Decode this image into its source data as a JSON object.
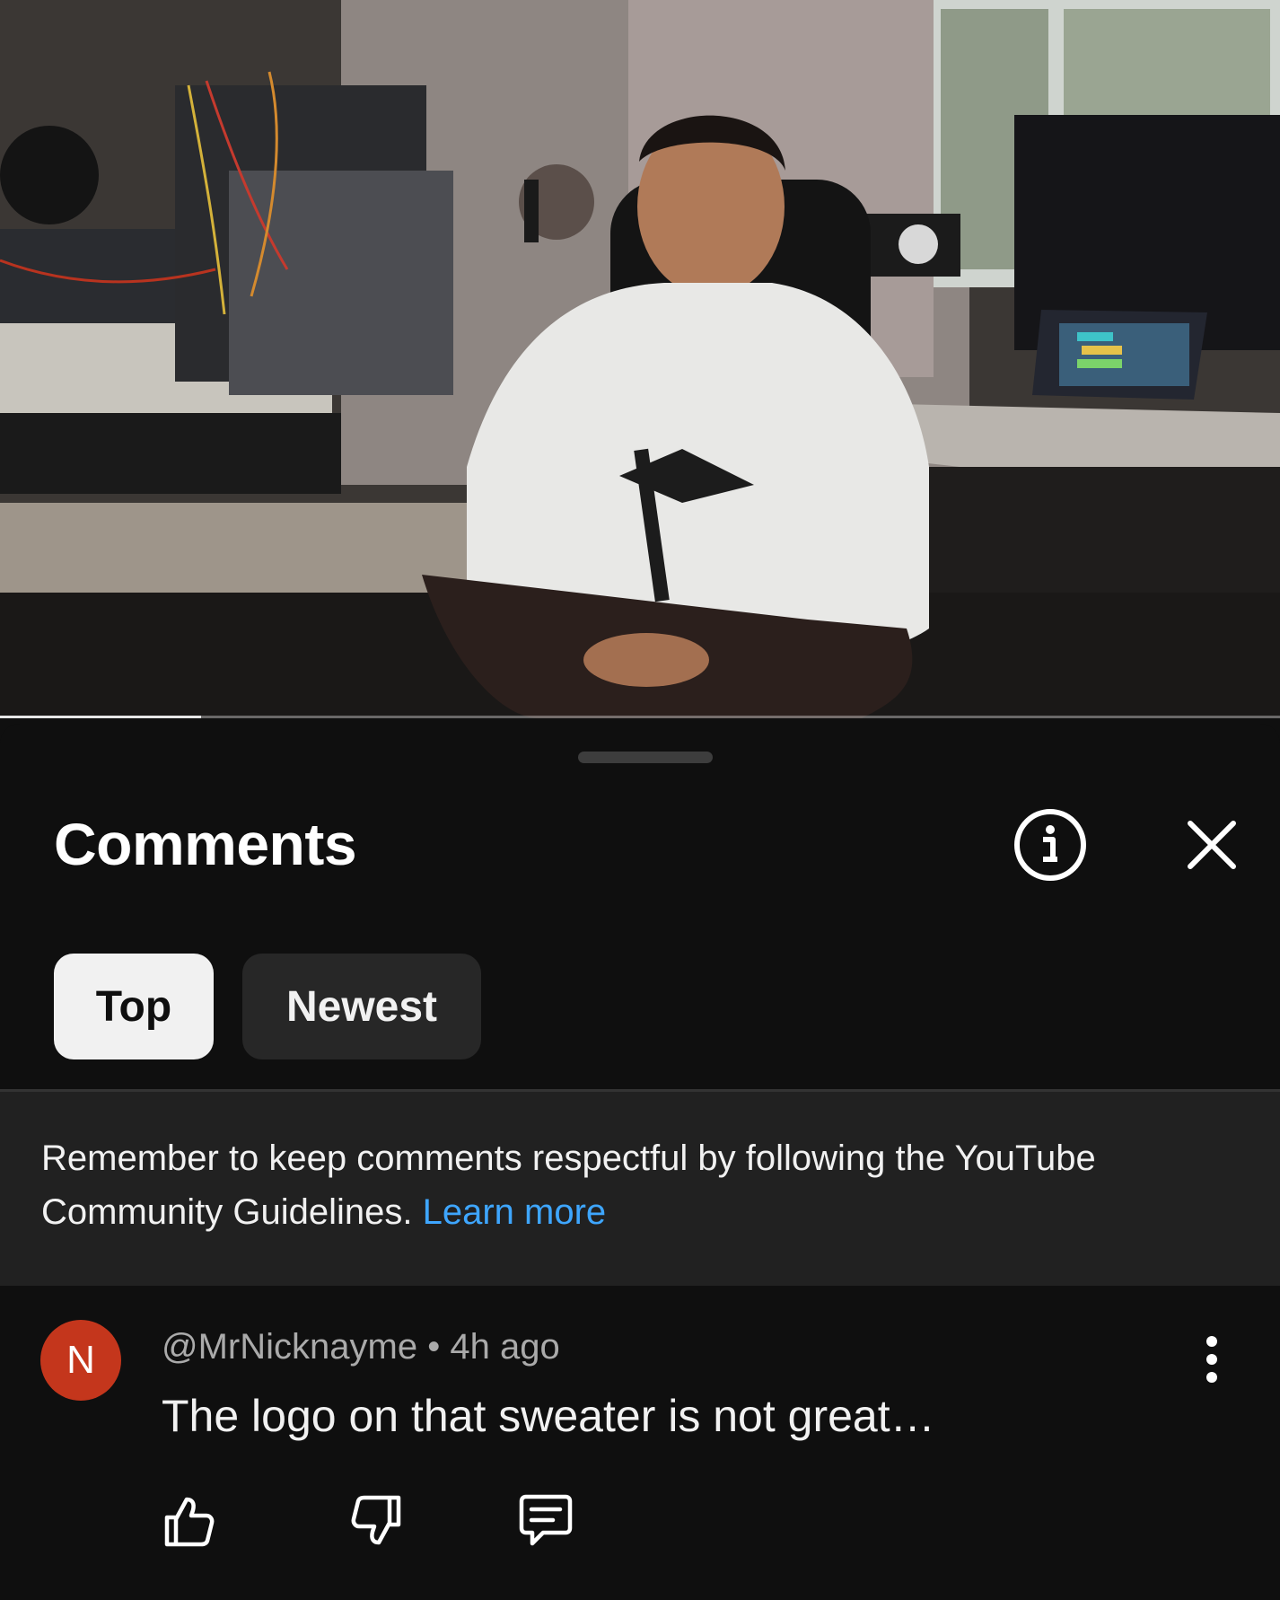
{
  "video": {
    "progress_fraction": 0.157
  },
  "comments_panel": {
    "title": "Comments",
    "info_icon": "info-icon",
    "close_icon": "close-icon",
    "filters": [
      {
        "label": "Top",
        "selected": true
      },
      {
        "label": "Newest",
        "selected": false
      }
    ],
    "notice": {
      "text": "Remember to keep comments respectful by following the YouTube Community Guidelines.",
      "link_text": "Learn more"
    },
    "comments": [
      {
        "avatar_letter": "N",
        "avatar_color": "#c4361c",
        "author": "@MrNicknayme",
        "separator": "•",
        "time": "4h ago",
        "text": "The logo on that sweater is not great…",
        "actions": [
          "thumbs-up-icon",
          "thumbs-down-icon",
          "reply-icon"
        ]
      }
    ]
  },
  "colors": {
    "background": "#0f0f0f",
    "chip_selected": "#f1f1f1",
    "chip_unselected": "#272727",
    "link": "#3ea6ff",
    "secondary_text": "#aaaaaa"
  }
}
